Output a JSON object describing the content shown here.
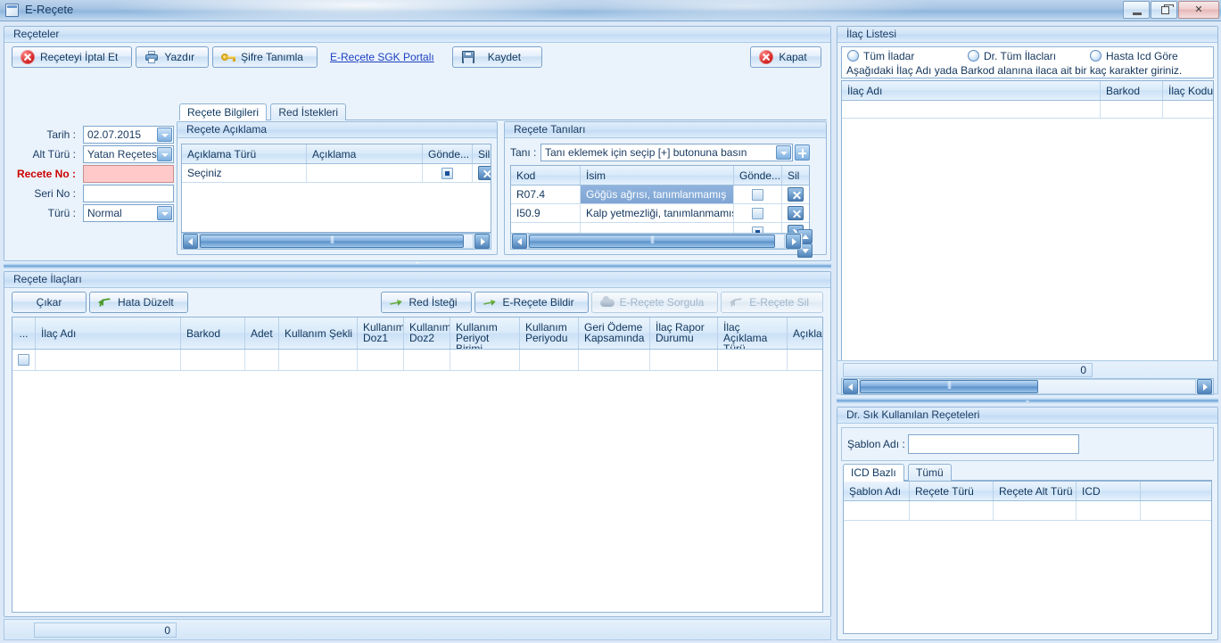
{
  "window": {
    "title": "E-Reçete",
    "icon": "document-icon",
    "buttons": {
      "minimize": "minimize-icon",
      "restore": "restore-icon",
      "close": "close-icon"
    }
  },
  "prescriptions_panel": {
    "title": "Reçeteler",
    "toolbar": [
      {
        "name": "cancel-prescription",
        "label": "Reçeteyi İptal Et",
        "icon": "cancel-icon",
        "style": "button",
        "disabled": false
      },
      {
        "name": "print",
        "label": "Yazdır",
        "icon": "print-icon",
        "style": "button",
        "disabled": false
      },
      {
        "name": "define-password",
        "label": "Şifre Tanımla",
        "icon": "key-icon",
        "style": "button",
        "disabled": false
      },
      {
        "name": "sgk-portal",
        "label": "E-Reçete SGK Portalı",
        "icon": "",
        "style": "link",
        "disabled": false
      },
      {
        "name": "save",
        "label": "Kaydet",
        "icon": "save-icon",
        "style": "button",
        "disabled": false
      }
    ],
    "close_button": {
      "label": "Kapat",
      "icon": "cancel-icon"
    },
    "tabs": [
      {
        "label": "Reçete Bilgileri",
        "active": true
      },
      {
        "label": "Red İstekleri",
        "active": false
      }
    ],
    "form": {
      "fields": [
        {
          "name": "date",
          "label": "Tarih :",
          "value": "02.07.2015",
          "type": "combo",
          "required": false
        },
        {
          "name": "sub-type",
          "label": "Alt Türü :",
          "value": "Yatan Reçetesi",
          "type": "combo",
          "required": false
        },
        {
          "name": "prescription-no",
          "label": "Recete No :",
          "value": "",
          "type": "text",
          "required": true
        },
        {
          "name": "serial-no",
          "label": "Seri No :",
          "value": "",
          "type": "text",
          "required": false
        },
        {
          "name": "type",
          "label": "Türü :",
          "value": "Normal",
          "type": "combo",
          "required": false
        }
      ]
    },
    "description_group": {
      "title": "Reçete Açıklama",
      "columns": [
        "Açıklama Türü",
        "Açıklama",
        "Gönde...",
        "Sil"
      ],
      "rows": [
        {
          "type": "Seçiniz",
          "description": "",
          "send": "checked-dot",
          "delete": "x-button"
        }
      ],
      "scroll_value": ""
    },
    "diagnoses_group": {
      "title": "Reçete Tanıları",
      "diagnosis_label": "Tanı :",
      "diagnosis_placeholder": "Tanı eklemek için seçip [+] butonuna basın",
      "diagnosis_value": "Tanı eklemek için seçip [+] butonuna basın",
      "add_button": "plus-icon",
      "columns": [
        "Kod",
        "İsim",
        "Gönde...",
        "Sil"
      ],
      "rows": [
        {
          "code": "R07.4",
          "name": "Göğüs ağrısı, tanımlanmamış",
          "selected": true
        },
        {
          "code": "I50.9",
          "name": "Kalp yetmezliği, tanımlanmamış",
          "selected": false
        },
        {
          "code": "",
          "name": "",
          "selected": false
        }
      ]
    }
  },
  "medications_panel": {
    "title": "Reçete İlaçları",
    "left_buttons": [
      {
        "name": "remove",
        "label": "Çıkar",
        "icon": "",
        "disabled": false
      },
      {
        "name": "fix-error",
        "label": "Hata Düzelt",
        "icon": "undo-icon",
        "disabled": false
      }
    ],
    "right_buttons": [
      {
        "name": "rejection-request",
        "label": "Red İsteği",
        "icon": "green-arrow-icon",
        "disabled": false
      },
      {
        "name": "notify-eprescription",
        "label": "E-Reçete Bildir",
        "icon": "green-arrow-icon",
        "disabled": false
      },
      {
        "name": "query-eprescription",
        "label": "E-Reçete Sorgula",
        "icon": "cloud-icon",
        "disabled": true
      },
      {
        "name": "delete-eprescription",
        "label": "E-Reçete Sil",
        "icon": "undo-icon",
        "disabled": true
      }
    ],
    "columns": [
      "...",
      "İlaç Adı",
      "Barkod",
      "Adet",
      "Kullanım Şekli",
      "Kullanım\nDoz1",
      "Kullanım\nDoz2",
      "Kullanım\nPeriyot Birimi",
      "Kullanım\nPeriyodu",
      "Geri Ödeme\nKapsamında",
      "İlaç Rapor\nDurumu",
      "İlaç Açıklama\nTürü",
      "Açıklama"
    ],
    "rows": [
      {
        "select": "checkbox",
        "name": "",
        "barcode": "",
        "qty": "",
        "usage": "",
        "dose1": "",
        "dose2": "",
        "period_unit": "",
        "period": "",
        "reimbursed": "",
        "report_status": "",
        "desc_type": "",
        "description": ""
      }
    ],
    "status_count": "0"
  },
  "medication_list_panel": {
    "title": "İlaç Listesi",
    "radios": [
      {
        "label": "Tüm İladar",
        "selected": false
      },
      {
        "label": "Dr. Tüm İlacları",
        "selected": false
      },
      {
        "label": "Hasta Icd Göre",
        "selected": false
      }
    ],
    "hint": "Aşağıdaki İlaç Adı yada Barkod alanına ilaca ait bir kaç karakter giriniz.",
    "columns": [
      "İlaç Adı",
      "Barkod",
      "İlaç Kodu"
    ],
    "rows": [],
    "status_count": "0"
  },
  "templates_panel": {
    "title": "Dr. Sık Kullanılan Reçeteleri",
    "template_label": "Şablon Adı :",
    "template_value": "",
    "tabs": [
      {
        "label": "ICD Bazlı",
        "active": true
      },
      {
        "label": "Tümü",
        "active": false
      }
    ],
    "columns": [
      "Şablon Adı",
      "Reçete Türü",
      "Reçete Alt Türü",
      "ICD",
      ""
    ],
    "rows": []
  },
  "colors": {
    "accent": "#1a3fc0",
    "required_field": "#ffc9c9",
    "required_label": "#cc0000",
    "panel_bg": "#eaf3fc",
    "border": "#98bada",
    "selection": "#8fb3dd"
  }
}
